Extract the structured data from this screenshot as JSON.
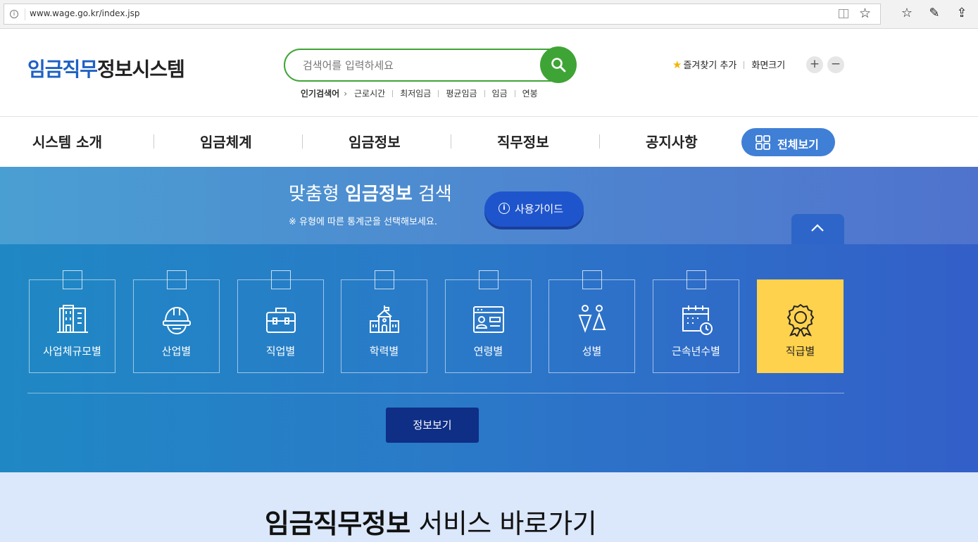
{
  "browser": {
    "url": "www.wage.go.kr/index.jsp",
    "info_icon": "i"
  },
  "header": {
    "logo_blue": "임금직무",
    "logo_dark": "정보시스템",
    "search_placeholder": "검색어를 입력하세요",
    "popular_label": "인기검색어",
    "popular_keywords": [
      "근로시간",
      "최저임금",
      "평균임금",
      "임금",
      "연봉"
    ],
    "favorite_label": "즐겨찾기 추가",
    "screen_size_label": "화면크기",
    "zoom_in": "+",
    "zoom_out": "−"
  },
  "nav": {
    "items": [
      "시스템 소개",
      "임금체계",
      "임금정보",
      "직무정보",
      "공지사항"
    ],
    "view_all": "전체보기"
  },
  "hero": {
    "title_plain": "맞춤형",
    "title_bold": "임금정보",
    "title_tail": "검색",
    "subtitle": "※ 유형에 따른 통계군을 선택해보세요.",
    "guide_button": "사용가이드",
    "categories": [
      {
        "label": "사업체규모별",
        "icon": "building-icon"
      },
      {
        "label": "산업별",
        "icon": "hardhat-icon"
      },
      {
        "label": "직업별",
        "icon": "toolbox-icon"
      },
      {
        "label": "학력별",
        "icon": "school-icon"
      },
      {
        "label": "연령별",
        "icon": "id-card-icon"
      },
      {
        "label": "성별",
        "icon": "gender-icon"
      },
      {
        "label": "근속년수별",
        "icon": "calendar-icon"
      },
      {
        "label": "직급별",
        "icon": "medal-icon"
      }
    ],
    "active_category": "직급별",
    "info_button": "정보보기"
  },
  "service": {
    "title_bold": "임금직무정보",
    "title_rest": "서비스 바로가기"
  },
  "colors": {
    "brand_blue": "#1d60c5",
    "search_green": "#3fa436",
    "active_yellow": "#ffd24d",
    "button_navy": "#0f2e86"
  }
}
